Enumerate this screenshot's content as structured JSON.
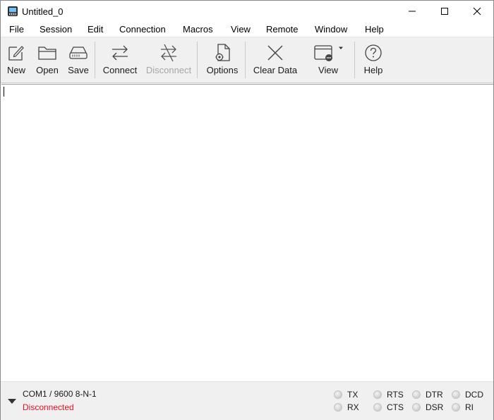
{
  "window": {
    "title": "Untitled_0"
  },
  "menu": [
    {
      "label": "File"
    },
    {
      "label": "Session"
    },
    {
      "label": "Edit"
    },
    {
      "label": "Connection"
    },
    {
      "label": "Macros"
    },
    {
      "label": "View"
    },
    {
      "label": "Remote"
    },
    {
      "label": "Window"
    },
    {
      "label": "Help"
    }
  ],
  "toolbar": {
    "new": {
      "label": "New",
      "icon": "new-document-icon"
    },
    "open": {
      "label": "Open",
      "icon": "folder-icon"
    },
    "save": {
      "label": "Save",
      "icon": "drive-icon"
    },
    "connect": {
      "label": "Connect",
      "icon": "connect-arrows-icon"
    },
    "disconnect": {
      "label": "Disconnect",
      "icon": "disconnect-arrows-icon",
      "enabled": false
    },
    "options": {
      "label": "Options",
      "icon": "document-gear-icon"
    },
    "clear": {
      "label": "Clear Data",
      "icon": "x-icon"
    },
    "view": {
      "label": "View",
      "icon": "window-view-icon"
    },
    "help": {
      "label": "Help",
      "icon": "question-circle-icon"
    }
  },
  "status": {
    "port": "COM1 / 9600 8-N-1",
    "connection_state": "Disconnected",
    "connection_state_color": "#e81123",
    "signals": [
      {
        "label": "TX",
        "active": false
      },
      {
        "label": "RX",
        "active": false
      },
      {
        "label": "RTS",
        "active": false
      },
      {
        "label": "CTS",
        "active": false
      },
      {
        "label": "DTR",
        "active": false
      },
      {
        "label": "DSR",
        "active": false
      },
      {
        "label": "DCD",
        "active": false
      },
      {
        "label": "RI",
        "active": false
      }
    ]
  }
}
